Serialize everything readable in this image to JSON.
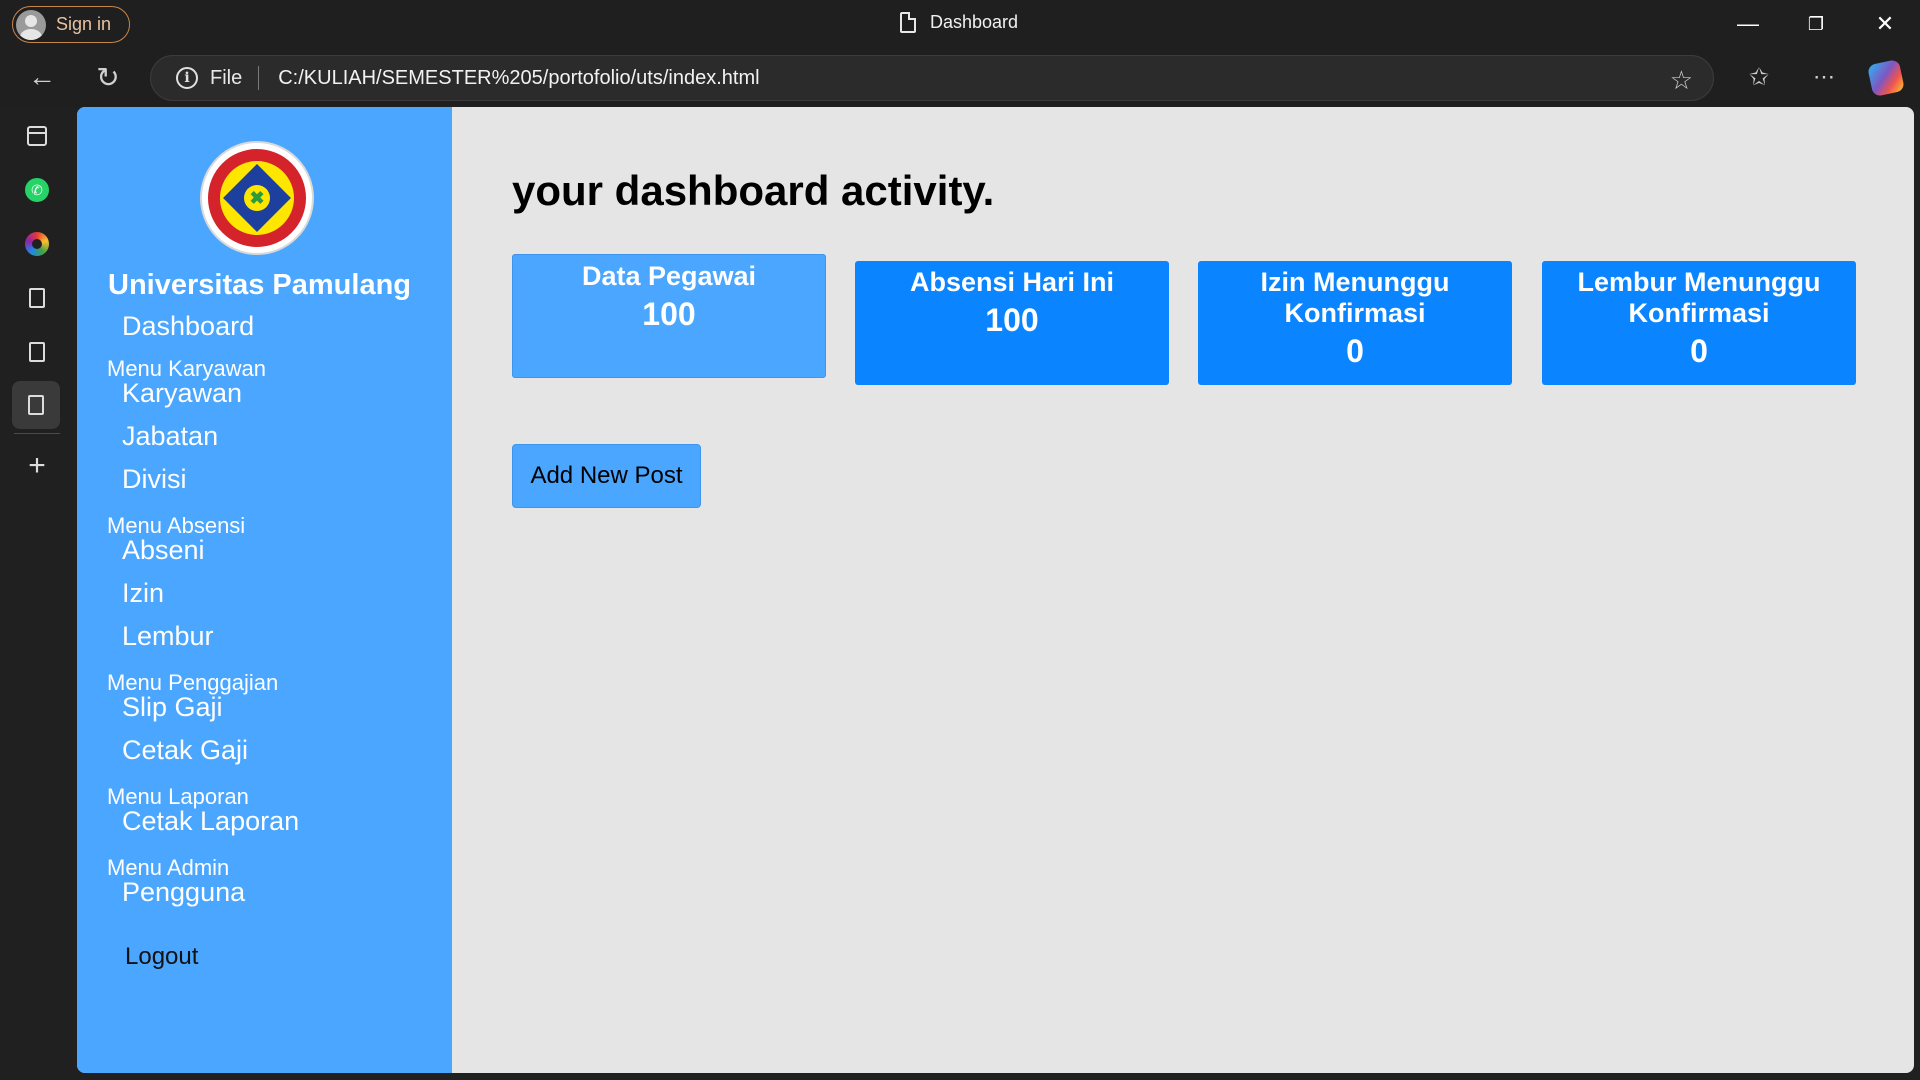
{
  "browser": {
    "signin_label": "Sign in",
    "tab_title": "Dashboard",
    "file_label": "File",
    "url": "C:/KULIAH/SEMESTER%205/portofolio/uts/index.html"
  },
  "sidebar": {
    "brand": "Universitas Pamulang",
    "dashboard": "Dashboard",
    "karyawan_head": "Menu Karyawan",
    "karyawan": "Karyawan",
    "jabatan": "Jabatan",
    "divisi": "Divisi",
    "absensi_head": "Menu Absensi",
    "abseni": "Abseni",
    "izin": "Izin",
    "lembur": "Lembur",
    "penggajian_head": "Menu Penggajian",
    "slip_gaji": "Slip Gaji",
    "cetak_gaji": "Cetak Gaji",
    "laporan_head": "Menu Laporan",
    "cetak_laporan": "Cetak Laporan",
    "admin_head": "Menu Admin",
    "pengguna": "Pengguna",
    "logout": "Logout"
  },
  "main": {
    "title": "your dashboard activity.",
    "cards": [
      {
        "title": "Data Pegawai",
        "value": "100"
      },
      {
        "title": "Absensi Hari Ini",
        "value": "100"
      },
      {
        "title": "Izin Menunggu Konfirmasi",
        "value": "0"
      },
      {
        "title": "Lembur Menunggu Konfirmasi",
        "value": "0"
      }
    ],
    "add_button": "Add New Post"
  },
  "colors": {
    "sidebar": "#4aa6ff",
    "card": "#0a84ff",
    "content_bg": "#e5e5e5"
  }
}
